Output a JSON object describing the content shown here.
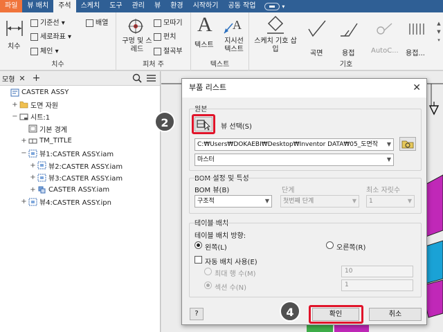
{
  "ribbon_tabs": [
    "파일",
    "뷰 배치",
    "주석",
    "스케치",
    "도구",
    "관리",
    "뷰",
    "환경",
    "시작하기",
    "공동 작업"
  ],
  "active_tab": "주석",
  "panels": {
    "dimension": {
      "title": "치수",
      "large": "치수",
      "items": [
        "기준선",
        "세로좌표",
        "체인"
      ],
      "array": "배열"
    },
    "feature_notes": {
      "title": "피처 주",
      "large": "구멍 및 스레드",
      "items": [
        "모따기",
        "펀치",
        "절곡부"
      ]
    },
    "text": {
      "title": "텍스트",
      "items": [
        "텍스트",
        "지시선 텍스트"
      ]
    },
    "symbols": {
      "title": "기호",
      "sketch_symbol": "스케치 기호 삽입",
      "items": [
        "곡면",
        "용접",
        "AutoC...",
        "용접..."
      ]
    }
  },
  "browser": {
    "tab_label": "모형",
    "tree": [
      {
        "label": "CASTER ASSY",
        "indent": 0,
        "twisty": "",
        "icon": "drawing"
      },
      {
        "label": "도면 자원",
        "indent": 1,
        "twisty": "+",
        "icon": "folder"
      },
      {
        "label": "시트:1",
        "indent": 1,
        "twisty": "−",
        "icon": "sheet"
      },
      {
        "label": "기본 경계",
        "indent": 2,
        "twisty": "",
        "icon": "border"
      },
      {
        "label": "TM_TITLE",
        "indent": 2,
        "twisty": "+",
        "icon": "titleblock"
      },
      {
        "label": "뷰1:CASTER ASSY.iam",
        "indent": 2,
        "twisty": "−",
        "icon": "view"
      },
      {
        "label": "뷰2:CASTER ASSY.iam",
        "indent": 3,
        "twisty": "+",
        "icon": "view"
      },
      {
        "label": "뷰3:CASTER ASSY.iam",
        "indent": 3,
        "twisty": "+",
        "icon": "view"
      },
      {
        "label": "CASTER ASSY.iam",
        "indent": 3,
        "twisty": "+",
        "icon": "assembly"
      },
      {
        "label": "뷰4:CASTER ASSY.ipn",
        "indent": 2,
        "twisty": "+",
        "icon": "view"
      }
    ]
  },
  "dialog": {
    "title": "부품 리스트",
    "source_label": "원본",
    "select_view": "뷰 선택(S)",
    "file_path": "C:₩Users₩DOKAEBI₩Desktop₩Inventor DATA₩05_도면작",
    "view_rep": "마스터",
    "bom_section": "BOM 설정 및 특성",
    "bom_view_label": "BOM 뷰(B)",
    "bom_view_value": "구조적",
    "level_label": "단계",
    "level_value": "첫번째 단계",
    "min_digits_label": "최소 자릿수",
    "min_digits_value": "1",
    "table_wrap_section": "테이블 배치",
    "wrap_direction_label": "테이블 배치 방향:",
    "left_option": "왼쪽(L)",
    "right_option": "오른쪽(R)",
    "direction_selected": "left",
    "auto_wrap_label": "자동 배치 사용(E)",
    "auto_wrap_checked": false,
    "max_rows_label": "최대 행 수(M)",
    "max_rows_value": "10",
    "num_sections_label": "섹션 수(N)",
    "num_sections_value": "1",
    "help_label": "?",
    "ok_label": "확인",
    "cancel_label": "취소"
  },
  "callouts": [
    "2",
    "4"
  ],
  "colors": {
    "tabbar": "#2f5f95",
    "file_tab": "#f0743b",
    "highlight": "#e0142a",
    "callout": "#505050",
    "model_magenta": "#c028b8",
    "model_cyan": "#1aa2d6"
  }
}
